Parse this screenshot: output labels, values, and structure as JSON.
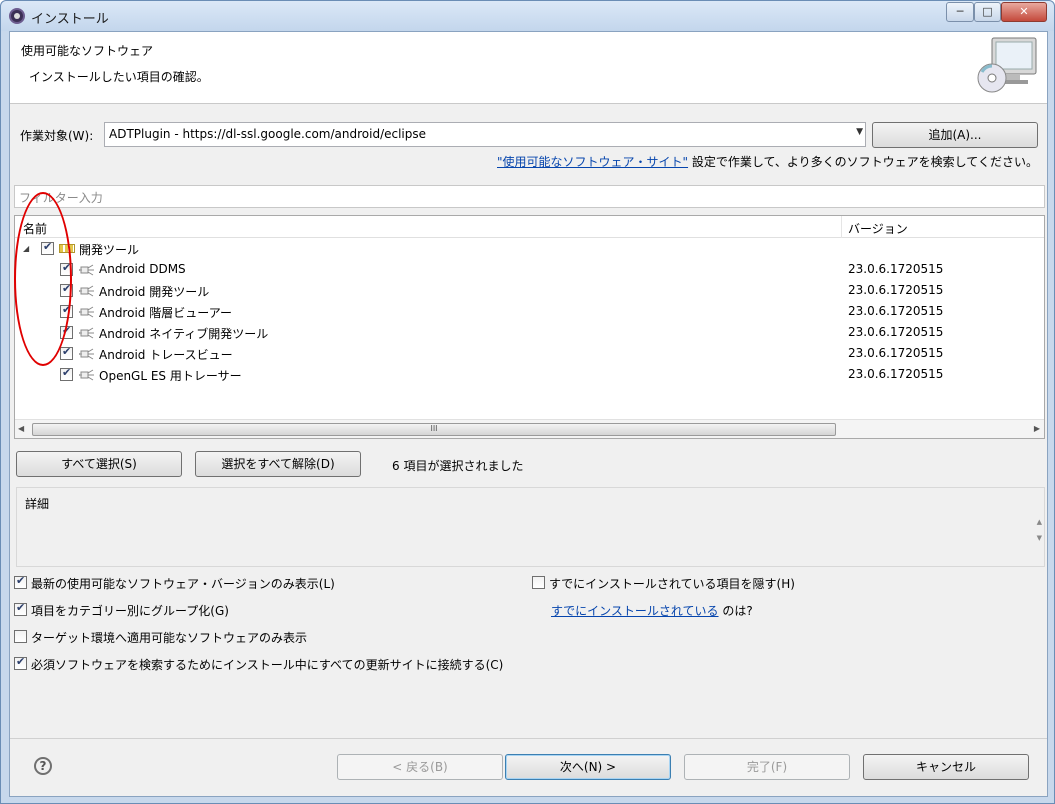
{
  "window": {
    "title": "インストール",
    "min": "─",
    "max": "□",
    "close": "✕"
  },
  "header": {
    "title": "使用可能なソフトウェア",
    "description": "インストールしたい項目の確認。"
  },
  "work_with": {
    "label": "作業対象(W):",
    "value": "ADTPlugin - https://dl-ssl.google.com/android/eclipse",
    "add_button": "追加(A)...",
    "site_link": "\"使用可能なソフトウェア・サイト\"",
    "site_suffix": " 設定で作業して、より多くのソフトウェアを検索してください。"
  },
  "filter": {
    "placeholder": "フィルター入力"
  },
  "tree": {
    "columns": {
      "name": "名前",
      "version": "バージョン"
    },
    "category": {
      "label": "開発ツール",
      "checked": true
    },
    "items": [
      {
        "label": "Android DDMS",
        "version": "23.0.6.1720515",
        "checked": true
      },
      {
        "label": "Android 開発ツール",
        "version": "23.0.6.1720515",
        "checked": true
      },
      {
        "label": "Android 階層ビューアー",
        "version": "23.0.6.1720515",
        "checked": true
      },
      {
        "label": "Android ネイティブ開発ツール",
        "version": "23.0.6.1720515",
        "checked": true
      },
      {
        "label": "Android トレースビュー",
        "version": "23.0.6.1720515",
        "checked": true
      },
      {
        "label": "OpenGL ES 用トレーサー",
        "version": "23.0.6.1720515",
        "checked": true
      }
    ],
    "scroll_thumb": "III"
  },
  "selection": {
    "select_all": "すべて選択(S)",
    "deselect_all": "選択をすべて解除(D)",
    "count_text": "6 項目が選択されました"
  },
  "details": {
    "label": "詳細"
  },
  "options": {
    "latest_only": {
      "label": "最新の使用可能なソフトウェア・バージョンのみ表示(L)",
      "checked": true
    },
    "hide_installed": {
      "label": "すでにインストールされている項目を隠す(H)",
      "checked": false
    },
    "group_by_category": {
      "label": "項目をカテゴリー別にグループ化(G)",
      "checked": true
    },
    "installed_link": "すでにインストールされている",
    "installed_suffix": " のは?",
    "target_only": {
      "label": "ターゲット環境へ適用可能なソフトウェアのみ表示",
      "checked": false
    },
    "contact_all_sites": {
      "label": "必須ソフトウェアを検索するためにインストール中にすべての更新サイトに接続する(C)",
      "checked": true
    }
  },
  "footer": {
    "help": "?",
    "back": "< 戻る(B)",
    "next": "次へ(N) >",
    "finish": "完了(F)",
    "cancel": "キャンセル"
  }
}
